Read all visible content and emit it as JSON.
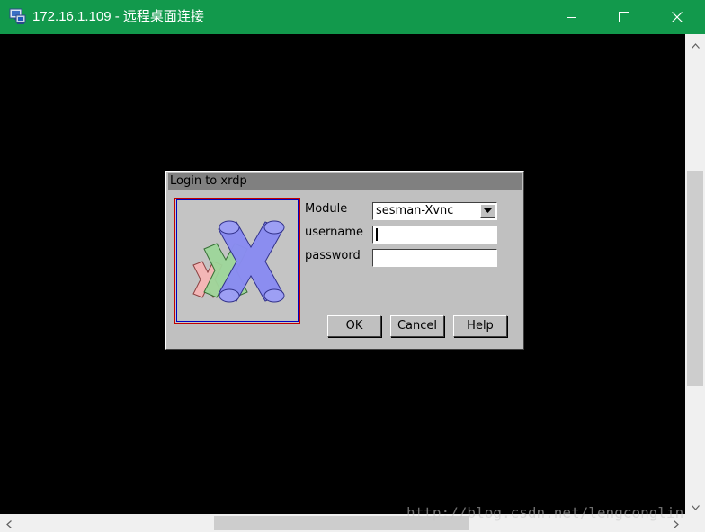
{
  "window": {
    "title": "172.16.1.109 - 远程桌面连接",
    "icon": "remote-desktop-icon",
    "controls": {
      "minimize": "minimize-icon",
      "maximize": "maximize-icon",
      "close": "close-icon"
    },
    "titlebar_color": "#12994c"
  },
  "dialog": {
    "title": "Login to xrdp",
    "logo": "xrdp-logo",
    "fields": {
      "module_label": "Module",
      "module_value": "sesman-Xvnc",
      "username_label": "username",
      "username_value": "",
      "password_label": "password",
      "password_value": ""
    },
    "buttons": {
      "ok": "OK",
      "cancel": "Cancel",
      "help": "Help"
    }
  },
  "watermark": "http://blog.csdn.net/lengconglin"
}
